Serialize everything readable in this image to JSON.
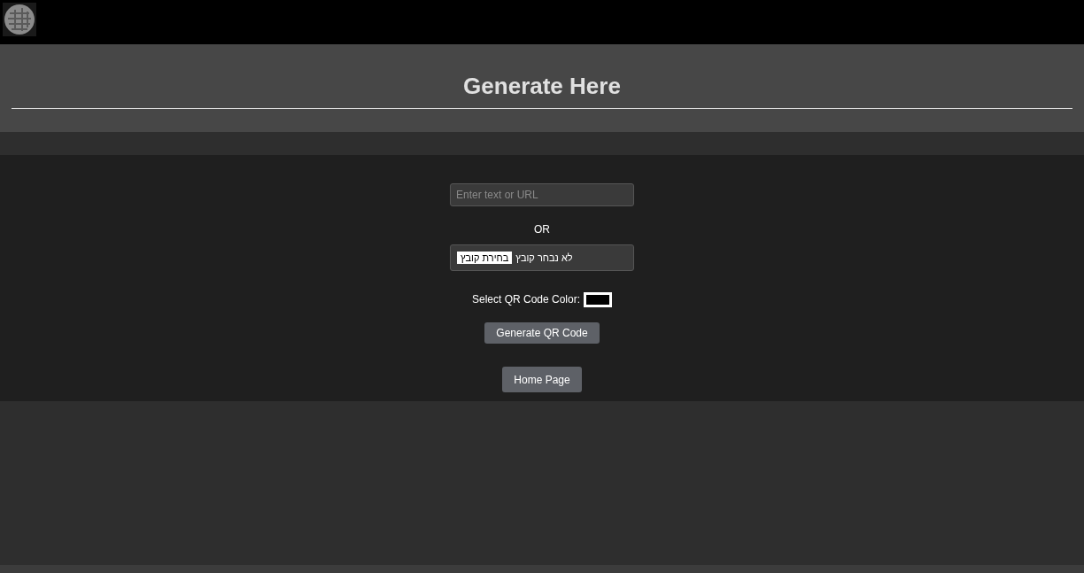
{
  "header": {
    "title": "Generate Here"
  },
  "form": {
    "text_input": {
      "placeholder": "Enter text or URL"
    },
    "separator": "OR",
    "file_input": {
      "button": "בחירת קובץ",
      "status": "לא נבחר קובץ"
    },
    "color_picker": {
      "label": "Select QR Code Color:",
      "color": "#000000"
    },
    "generate_button": "Generate QR Code"
  },
  "home_button": "Home Page"
}
